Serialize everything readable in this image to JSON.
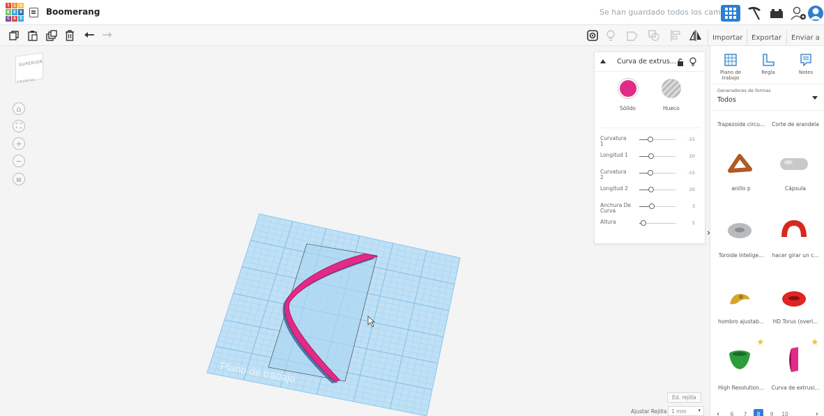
{
  "app": {
    "logo_letters": [
      "TIN",
      "KER",
      "CAD"
    ],
    "logo_colors": [
      "#e2473c",
      "#f08a3a",
      "#f2c543",
      "#79c36e",
      "#3fa6e0",
      "#2e6fb8",
      "#7b4fa0",
      "#e2473c",
      "#3fa6e0"
    ],
    "design_title": "Boomerang",
    "save_status": "Se han guardado todos los cambios."
  },
  "header_icons": [
    "grid-view-icon",
    "pickaxe-icon",
    "bricks-icon",
    "add-user-icon",
    "avatar-icon"
  ],
  "toolbar": {
    "left_tools": [
      "copy-icon",
      "paste-icon",
      "duplicate-icon",
      "delete-icon",
      "undo-icon",
      "redo-icon"
    ],
    "right_tools": [
      "camera-icon",
      "bulb-icon",
      "group-icon",
      "ungroup-icon",
      "align-icon",
      "mirror-icon"
    ],
    "import_label": "Importar",
    "export_label": "Exportar",
    "send_label": "Enviar a"
  },
  "viewcube": {
    "top_label": "SUPERIOR",
    "front_label": "FRONTAL"
  },
  "nav_controls": [
    "home-view-icon",
    "fit-view-icon",
    "zoom-in-icon",
    "zoom-out-icon",
    "orthographic-icon"
  ],
  "workplane": {
    "label": "Plano de trabajo"
  },
  "inspector": {
    "title": "Curva de extrus...",
    "solid_label": "Sólido",
    "hole_label": "Hueco",
    "solid_color": "#e22b86",
    "params": [
      {
        "label": "Curvatura 1",
        "value": "-15",
        "position": 0.2
      },
      {
        "label": "Longitud 1",
        "value": "20",
        "position": 0.22
      },
      {
        "label": "Curvatura 2",
        "value": "-15",
        "position": 0.2
      },
      {
        "label": "Longitud 2",
        "value": "20",
        "position": 0.22
      },
      {
        "label": "Anchura De Curva",
        "value": "3",
        "position": 0.24
      },
      {
        "label": "Altura",
        "value": "5",
        "position": 0.0
      }
    ]
  },
  "shapes_panel": {
    "tools": [
      {
        "label": "Plano de trabajo",
        "icon": "workplane-icon"
      },
      {
        "label": "Regla",
        "icon": "ruler-icon"
      },
      {
        "label": "Notes",
        "icon": "notes-icon"
      }
    ],
    "generators_label": "Generadores de formas",
    "generators_value": "Todos",
    "top_labels": [
      "Trapezoide circu...",
      "Corte de arandela"
    ],
    "shapes": [
      {
        "label": "anillo p",
        "color": "#b05a26",
        "icon": "triangle-ring-shape"
      },
      {
        "label": "Cápsula",
        "color": "#c7c9cb",
        "icon": "capsule-shape"
      },
      {
        "label": "Toroide Intelige...",
        "color": "#b9bbbd",
        "icon": "torus-shape"
      },
      {
        "label": "hacer girar un c...",
        "color": "#d7281d",
        "icon": "revolve-shape"
      },
      {
        "label": "hombro ajustab...",
        "color": "#d4a62a",
        "icon": "shoulder-shape"
      },
      {
        "label": "HD Torus (overl...",
        "color": "#e02424",
        "icon": "hd-torus-shape"
      },
      {
        "label": "High Resolution...",
        "color": "#2e9c3b",
        "icon": "cone-shape"
      },
      {
        "label": "Curva de extrusi...",
        "color": "#e22b86",
        "icon": "extrusion-curve-shape"
      }
    ],
    "pages": [
      "6",
      "7",
      "8",
      "9",
      "10"
    ],
    "active_page": "8"
  },
  "grid_controls": {
    "edit_grid_label": "Ed. rejilla",
    "snap_label": "Ajustar Rejilla",
    "snap_value": "1 mm"
  }
}
